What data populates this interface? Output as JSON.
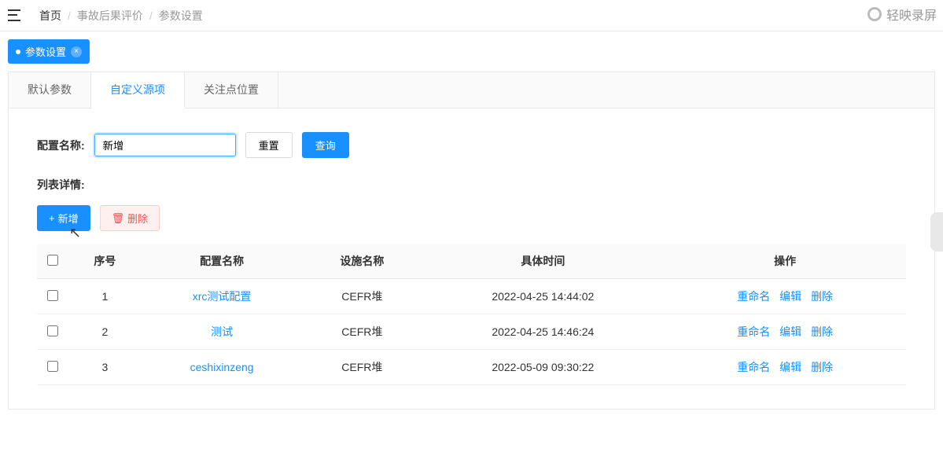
{
  "breadcrumb": {
    "home": "首页",
    "level1": "事故后果评价",
    "level2": "参数设置"
  },
  "watermark": "轻映录屏",
  "pageTab": {
    "label": "参数设置"
  },
  "innerTabs": [
    {
      "label": "默认参数",
      "active": false
    },
    {
      "label": "自定义源项",
      "active": true
    },
    {
      "label": "关注点位置",
      "active": false
    }
  ],
  "filter": {
    "label": "配置名称:",
    "value": "新增",
    "resetLabel": "重置",
    "searchLabel": "查询"
  },
  "list": {
    "title": "列表详情:",
    "addLabel": "新增",
    "deleteLabel": "删除",
    "col_seq": "序号",
    "col_name": "配置名称",
    "col_facility": "设施名称",
    "col_time": "具体时间",
    "col_ops": "操作",
    "op_rename": "重命名",
    "op_edit": "编辑",
    "op_delete": "删除",
    "rows": [
      {
        "seq": "1",
        "name": "xrc测试配置",
        "facility": "CEFR堆",
        "time": "2022-04-25 14:44:02"
      },
      {
        "seq": "2",
        "name": "测试",
        "facility": "CEFR堆",
        "time": "2022-04-25 14:46:24"
      },
      {
        "seq": "3",
        "name": "ceshixinzeng",
        "facility": "CEFR堆",
        "time": "2022-05-09 09:30:22"
      }
    ]
  }
}
